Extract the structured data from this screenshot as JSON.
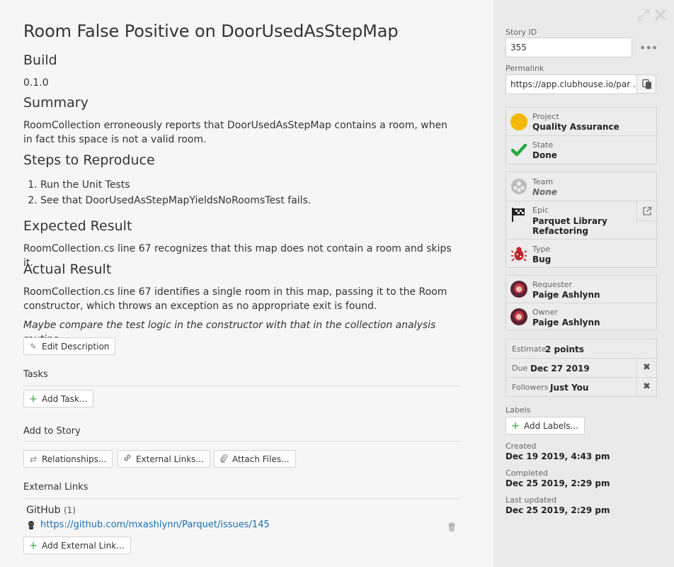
{
  "story": {
    "title": "Room False Positive on DoorUsedAsStepMap",
    "build_heading": "Build",
    "build_value": "0.1.0",
    "summary_heading": "Summary",
    "summary_text": "RoomCollection erroneously reports that DoorUsedAsStepMap contains a room, when in fact this space is not a valid room.",
    "steps_heading": "Steps to Reproduce",
    "steps": [
      "Run the Unit Tests",
      "See that DoorUsedAsStepMapYieldsNoRoomsTest fails."
    ],
    "expected_heading": "Expected Result",
    "expected_text": "RoomCollection.cs line 67 recognizes that this map does not contain a room and skips it.",
    "actual_heading": "Actual Result",
    "actual_text": "RoomCollection.cs line 67 identifies a single room in this map, passing it to the Room constructor, which throws an exception as no appropriate exit is found.",
    "note_text": "Maybe compare the test logic in the constructor with that in the collection analysis routine.",
    "edit_description_label": "Edit Description"
  },
  "tasks": {
    "heading": "Tasks",
    "add_label": "Add Task..."
  },
  "add_to_story": {
    "heading": "Add to Story",
    "relationships_label": "Relationships...",
    "external_links_label": "External Links...",
    "attach_files_label": "Attach Files..."
  },
  "external_links": {
    "heading": "External Links",
    "group_name": "GitHub",
    "group_count": "(1)",
    "link_url": "https://github.com/mxashlynn/Parquet/issues/145",
    "add_label": "Add External Link..."
  },
  "sidebar": {
    "story_id_label": "Story ID",
    "story_id_value": "355",
    "permalink_label": "Permalink",
    "permalink_value": "https://app.clubhouse.io/par ...",
    "project_label": "Project",
    "project_value": "Quality Assurance",
    "project_color": "#f5b800",
    "state_label": "State",
    "state_value": "Done",
    "state_color": "#27a844",
    "team_label": "Team",
    "team_value": "None",
    "epic_label": "Epic",
    "epic_value": "Parquet Library Refactoring",
    "type_label": "Type",
    "type_value": "Bug",
    "type_color": "#c0262d",
    "requester_label": "Requester",
    "requester_value": "Paige Ashlynn",
    "owner_label": "Owner",
    "owner_value": "Paige Ashlynn",
    "estimate_label": "Estimate",
    "estimate_value": "2 points",
    "due_label": "Due",
    "due_value": "Dec 27 2019",
    "followers_label": "Followers",
    "followers_value": "Just You",
    "labels_label": "Labels",
    "add_labels_label": "Add Labels...",
    "created_label": "Created",
    "created_value": "Dec 19 2019, 4:43 pm",
    "completed_label": "Completed",
    "completed_value": "Dec 25 2019, 2:29 pm",
    "updated_label": "Last updated",
    "updated_value": "Dec 25 2019, 2:29 pm"
  }
}
